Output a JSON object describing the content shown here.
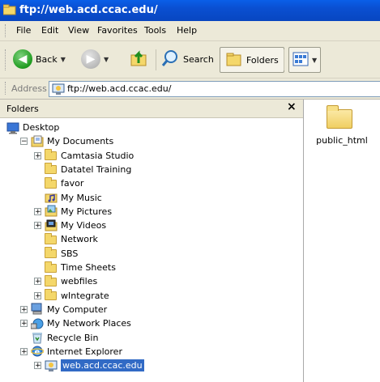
{
  "window": {
    "title": "ftp://web.acd.ccac.edu/"
  },
  "menu": [
    "File",
    "Edit",
    "View",
    "Favorites",
    "Tools",
    "Help"
  ],
  "toolbar": {
    "back": "Back",
    "search": "Search",
    "folders": "Folders"
  },
  "address": {
    "label": "Address",
    "value": "ftp://web.acd.ccac.edu/"
  },
  "folders_pane": {
    "title": "Folders",
    "close": "×",
    "items": [
      {
        "label": "Desktop",
        "level": 0,
        "expander": "",
        "icon": "desktop-icon"
      },
      {
        "label": "My Documents",
        "level": 1,
        "expander": "−",
        "icon": "my-documents-icon"
      },
      {
        "label": "Camtasia Studio",
        "level": 2,
        "expander": "+",
        "icon": "folder-icon"
      },
      {
        "label": "Datatel Training",
        "level": 2,
        "expander": "",
        "icon": "folder-icon"
      },
      {
        "label": "favor",
        "level": 2,
        "expander": "",
        "icon": "folder-icon"
      },
      {
        "label": "My Music",
        "level": 2,
        "expander": "",
        "icon": "my-music-icon"
      },
      {
        "label": "My Pictures",
        "level": 2,
        "expander": "+",
        "icon": "my-pictures-icon"
      },
      {
        "label": "My Videos",
        "level": 2,
        "expander": "+",
        "icon": "my-videos-icon"
      },
      {
        "label": "Network",
        "level": 2,
        "expander": "",
        "icon": "folder-icon"
      },
      {
        "label": "SBS",
        "level": 2,
        "expander": "",
        "icon": "folder-icon"
      },
      {
        "label": "Time Sheets",
        "level": 2,
        "expander": "",
        "icon": "folder-icon"
      },
      {
        "label": "webfiles",
        "level": 2,
        "expander": "+",
        "icon": "folder-icon"
      },
      {
        "label": "wIntegrate",
        "level": 2,
        "expander": "+",
        "icon": "folder-icon"
      },
      {
        "label": "My Computer",
        "level": 1,
        "expander": "+",
        "icon": "my-computer-icon"
      },
      {
        "label": "My Network Places",
        "level": 1,
        "expander": "+",
        "icon": "network-places-icon"
      },
      {
        "label": "Recycle Bin",
        "level": 1,
        "expander": "",
        "icon": "recycle-bin-icon"
      },
      {
        "label": "Internet Explorer",
        "level": 1,
        "expander": "+",
        "icon": "internet-explorer-icon"
      },
      {
        "label": "web.acd.ccac.edu",
        "level": 2,
        "expander": "+",
        "icon": "ftp-site-icon",
        "selected": true
      }
    ]
  },
  "content": {
    "items": [
      {
        "label": "public_html",
        "icon": "folder-icon"
      }
    ]
  }
}
